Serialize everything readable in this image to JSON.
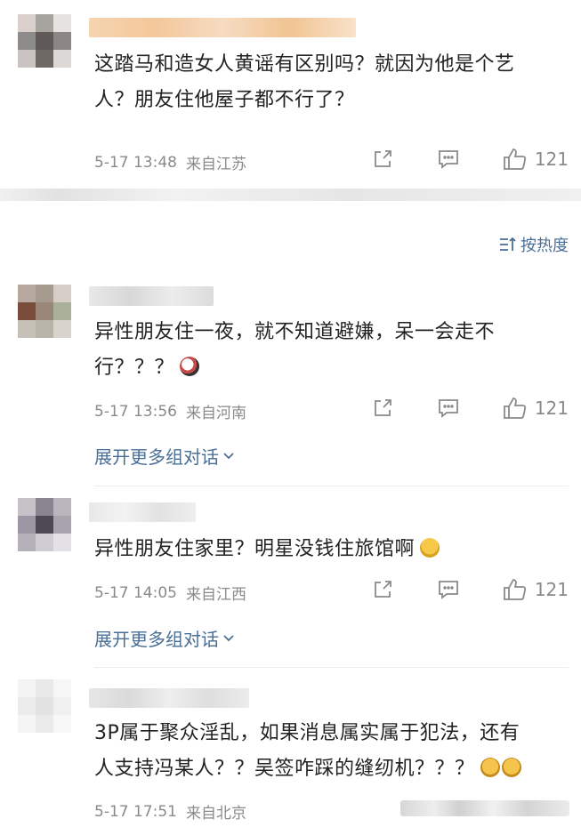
{
  "sort": {
    "label": "按热度"
  },
  "comments": [
    {
      "text_line1": "这踏马和造女人黄谣有区别吗？就因为他是个艺",
      "text_line2": "人？朋友住他屋子都不行了？",
      "time": "5-17 13:48",
      "location": "来自江苏",
      "likes": "121",
      "expand": ""
    },
    {
      "text_line1": "异性朋友住一夜，就不知道避嫌，呆一会走不",
      "text_line2": "行？？？",
      "time": "5-17 13:56",
      "location": "来自河南",
      "likes": "121",
      "expand": "展开更多组对话"
    },
    {
      "text_line1": "异性朋友住家里？明星没钱住旅馆啊",
      "text_line2": "",
      "time": "5-17 14:05",
      "location": "来自江西",
      "likes": "121",
      "expand": "展开更多组对话"
    },
    {
      "text_line1": "3P属于聚众淫乱，如果消息属实属于犯法，还有",
      "text_line2": "人支持冯某人？？吴签咋踩的缝纫机？？？",
      "time": "5-17 17:51",
      "location": "来自北京",
      "likes": "",
      "expand": ""
    }
  ],
  "colors": {
    "link": "#4a6f96",
    "meta": "#8a8a8a",
    "text": "#222222"
  },
  "icons": [
    "share-icon",
    "reply-icon",
    "like-icon",
    "sort-icon",
    "chevron-down-icon",
    "emoji-icon"
  ]
}
